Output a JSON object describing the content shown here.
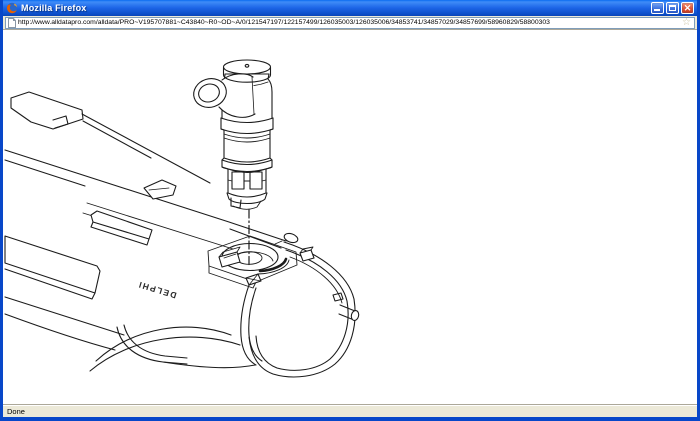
{
  "window": {
    "title": "Mozilla Firefox",
    "app_icon": "firefox-logo-icon",
    "controls": [
      {
        "name": "minimize"
      },
      {
        "name": "maximize"
      },
      {
        "name": "close"
      }
    ]
  },
  "toolbar": {
    "page_icon": "document-page-icon",
    "url": "http://www.alldatapro.com/alldata/PRO~V195707881~C43840~R0~OD~A/0/121547197/122157499/126035003/126035006/34853741/34857029/34857699/58960829/58800303",
    "go_icon": "star-icon"
  },
  "content": {
    "diagram": {
      "type": "technical-line-drawing",
      "subject": "Purge solenoid valve shown above its mounting port on a fuel tank, with dashed insertion guide line",
      "tank_label": "DELPHI"
    }
  },
  "statusbar": {
    "text": "Done"
  },
  "colors": {
    "titlebar_blue": "#1C64E6",
    "frame_blue": "#0847C9",
    "chrome_tan": "#ECE9D8",
    "close_red": "#DD5436",
    "url_border": "#7F9DB9",
    "line_art": "#1C1C1C"
  }
}
